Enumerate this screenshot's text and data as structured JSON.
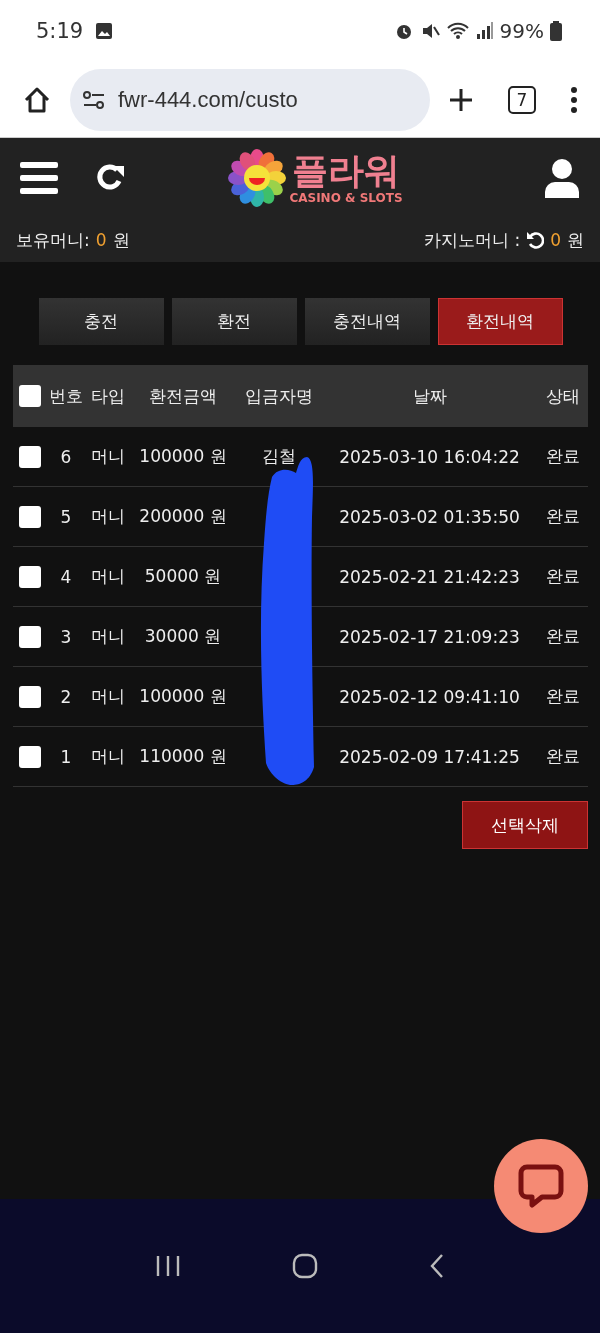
{
  "status_bar": {
    "time": "5:19",
    "battery": "99%"
  },
  "browser": {
    "url": "fwr-444.com/custo",
    "tab_count": "7"
  },
  "header": {
    "logo_title": "플라워",
    "logo_subtitle": "CASINO & SLOTS"
  },
  "balances": {
    "held_label": "보유머니:",
    "held_value": "0",
    "held_unit": "원",
    "casino_label": "카지노머니 :",
    "casino_value": "0",
    "casino_unit": "원"
  },
  "tabs": [
    {
      "label": "충전",
      "selected": false
    },
    {
      "label": "환전",
      "selected": false
    },
    {
      "label": "충전내역",
      "selected": false
    },
    {
      "label": "환전내역",
      "selected": true
    }
  ],
  "table": {
    "all_checked": false,
    "columns": [
      "번호",
      "타입",
      "환전금액",
      "입금자명",
      "날짜",
      "상태"
    ],
    "rows": [
      {
        "checked": false,
        "no": "6",
        "type": "머니",
        "amount": "100000 원",
        "name": "김철",
        "date": "2025-03-10 16:04:22",
        "status": "완료"
      },
      {
        "checked": false,
        "no": "5",
        "type": "머니",
        "amount": "200000 원",
        "date": "2025-03-02 01:35:50",
        "status": "완료"
      },
      {
        "checked": false,
        "no": "4",
        "type": "머니",
        "amount": "50000 원",
        "date": "2025-02-21 21:42:23",
        "status": "완료"
      },
      {
        "checked": false,
        "no": "3",
        "type": "머니",
        "amount": "30000 원",
        "date": "2025-02-17 21:09:23",
        "status": "완료"
      },
      {
        "checked": false,
        "no": "2",
        "type": "머니",
        "amount": "100000 원",
        "date": "2025-02-12 09:41:10",
        "status": "완료"
      },
      {
        "checked": false,
        "no": "1",
        "type": "머니",
        "amount": "110000 원",
        "date": "2025-02-09 17:41:25",
        "status": "완료"
      }
    ]
  },
  "delete_button": "선택삭제"
}
